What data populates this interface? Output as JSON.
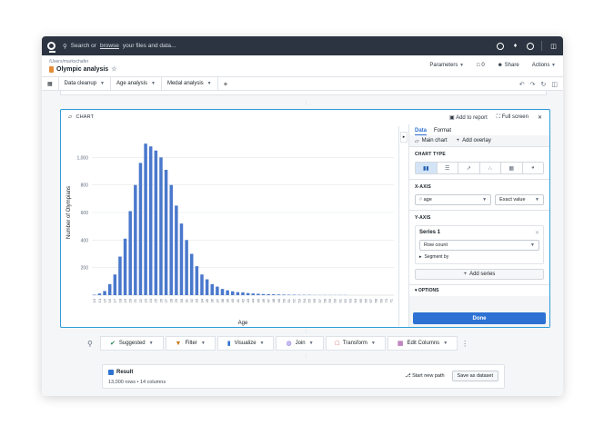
{
  "topbar": {
    "search_prefix": "Search or",
    "search_link": "browse",
    "search_suffix": "your files and data..."
  },
  "header": {
    "path": "/Users/markschafer",
    "title": "Olympic analysis",
    "parameters": "Parameters",
    "comments_count": "0",
    "share": "Share",
    "actions": "Actions"
  },
  "tabs": [
    {
      "label": "Data cleanup"
    },
    {
      "label": "Age analysis"
    },
    {
      "label": "Medal analysis"
    }
  ],
  "panel": {
    "label": "CHART",
    "add_to_report": "Add to report",
    "full_screen": "Full screen"
  },
  "config": {
    "tab_data": "Data",
    "tab_format": "Format",
    "main_chart": "Main chart",
    "add_overlay": "Add overlay",
    "chart_type_title": "CHART TYPE",
    "x_axis_title": "X-AXIS",
    "x_field": "age",
    "x_mode": "Exact value",
    "y_axis_title": "Y-AXIS",
    "series_name": "Series 1",
    "series_agg": "Row count",
    "segment_by": "Segment by",
    "add_series": "Add series",
    "options_title": "OPTIONS",
    "done": "Done"
  },
  "transforms": {
    "suggested": "Suggested",
    "filter": "Filter",
    "visualize": "Visualize",
    "join": "Join",
    "transform": "Transform",
    "edit_columns": "Edit Columns"
  },
  "result": {
    "title": "Result",
    "summary": "13,000 rows • 14 columns",
    "start_new_path": "Start new path",
    "save_as_dataset": "Save as dataset"
  },
  "colors": {
    "bar": "#4a78cc",
    "accent": "#2d72d2"
  },
  "chart_data": {
    "type": "bar",
    "xlabel": "Age",
    "ylabel": "Number of Olympians",
    "ylim": [
      0,
      1200
    ],
    "yticks": [
      200,
      400,
      600,
      800,
      1000
    ],
    "grid": true,
    "categories": [
      "13",
      "14",
      "15",
      "16",
      "17",
      "18",
      "19",
      "20",
      "21",
      "22",
      "23",
      "24",
      "25",
      "26",
      "27",
      "28",
      "29",
      "30",
      "31",
      "32",
      "33",
      "34",
      "35",
      "36",
      "37",
      "38",
      "39",
      "40",
      "41",
      "42",
      "43",
      "44",
      "45",
      "46",
      "47",
      "48",
      "49",
      "50",
      "51",
      "52",
      "53",
      "54",
      "55",
      "56",
      "57",
      "58",
      "59",
      "60",
      "61",
      "62",
      "63",
      "64",
      "65",
      "66",
      "67",
      "68",
      "69",
      "70",
      "71"
    ],
    "values": [
      3,
      12,
      30,
      80,
      150,
      280,
      410,
      610,
      800,
      960,
      1100,
      1080,
      1050,
      1000,
      910,
      800,
      650,
      520,
      400,
      300,
      210,
      150,
      115,
      80,
      62,
      45,
      35,
      28,
      22,
      20,
      15,
      12,
      10,
      8,
      7,
      6,
      5,
      4,
      3,
      3,
      2,
      2,
      2,
      1,
      1,
      1,
      1,
      1,
      1,
      1,
      0,
      0,
      0,
      0,
      0,
      0,
      0,
      0,
      0
    ]
  }
}
